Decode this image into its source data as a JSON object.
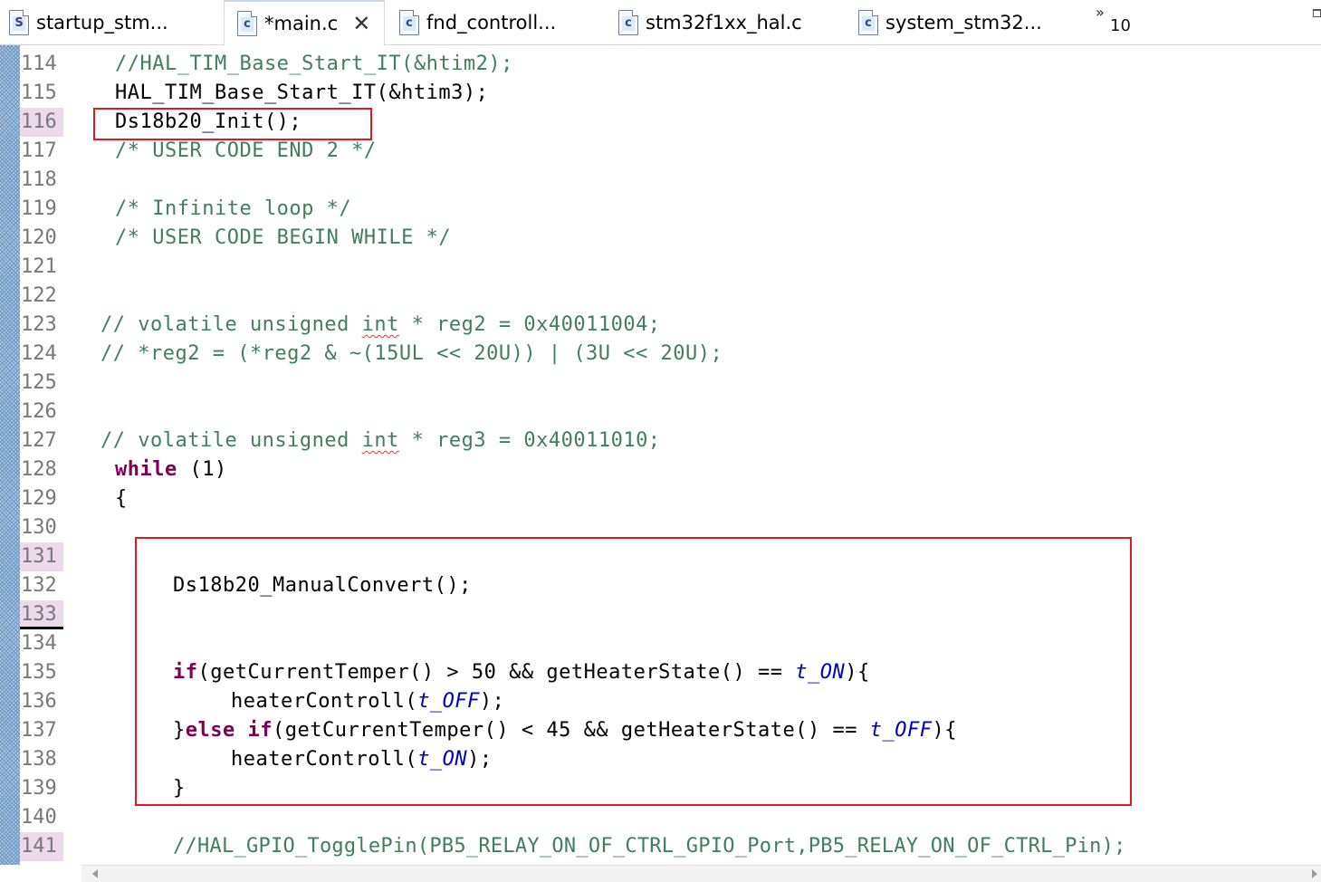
{
  "tabs": [
    {
      "label": "startup_stm...",
      "icon": "asm-file-icon",
      "glyph": "S",
      "active": false
    },
    {
      "label": "*main.c",
      "icon": "c-file-icon",
      "glyph": "c",
      "active": true
    },
    {
      "label": "fnd_controll...",
      "icon": "c-file-icon",
      "glyph": "c",
      "active": false
    },
    {
      "label": "stm32f1xx_hal.c",
      "icon": "c-file-icon",
      "glyph": "c",
      "active": false
    },
    {
      "label": "system_stm32...",
      "icon": "c-file-icon",
      "glyph": "c",
      "active": false
    }
  ],
  "overflow": {
    "chevron": "»",
    "count": "10"
  },
  "line_numbers": [
    "114",
    "115",
    "116",
    "117",
    "118",
    "119",
    "120",
    "121",
    "122",
    "123",
    "124",
    "125",
    "126",
    "127",
    "128",
    "129",
    "130",
    "131",
    "132",
    "133",
    "134",
    "135",
    "136",
    "137",
    "138",
    "139",
    "140",
    "141"
  ],
  "code": {
    "l114": "//HAL_TIM_Base_Start_IT(&htim2);",
    "l115": "HAL_TIM_Base_Start_IT(&htim3);",
    "l116": "Ds18b20_Init();",
    "l117": "/* USER CODE END 2 */",
    "l119": "/* Infinite loop */",
    "l120": "/* USER CODE BEGIN WHILE */",
    "l123a": "// volatile unsigned ",
    "l123b": "int",
    "l123c": " * reg2 = 0x40011004;",
    "l124": "// *reg2 = (*reg2 & ~(15UL << 20U)) | (3U << 20U);",
    "l127a": "// volatile unsigned ",
    "l127b": "int",
    "l127c": " * reg3 = 0x40011010;",
    "l128a": "while",
    "l128b": " (1)",
    "l129": "{",
    "l132": "Ds18b20_ManualConvert();",
    "l135a": "if",
    "l135b": "(getCurrentTemper() > 50 && getHeaterState() == ",
    "l135c": "t_ON",
    "l135d": "){",
    "l136a": "heaterControll(",
    "l136b": "t_OFF",
    "l136c": ");",
    "l137a": "}",
    "l137b": "else if",
    "l137c": "(getCurrentTemper() < 45 && getHeaterState() == ",
    "l137d": "t_OFF",
    "l137e": "){",
    "l138a": "heaterControll(",
    "l138b": "t_ON",
    "l138c": ");",
    "l139": "}",
    "l141": "//HAL_GPIO_TogglePin(PB5_RELAY_ON_OF_CTRL_GPIO_Port,PB5_RELAY_ON_OF_CTRL_Pin);"
  },
  "colors": {
    "comment": "#3f7f5f",
    "keyword": "#7f0055",
    "enum": "#0000c0",
    "highlight_box": "#e8141e"
  }
}
